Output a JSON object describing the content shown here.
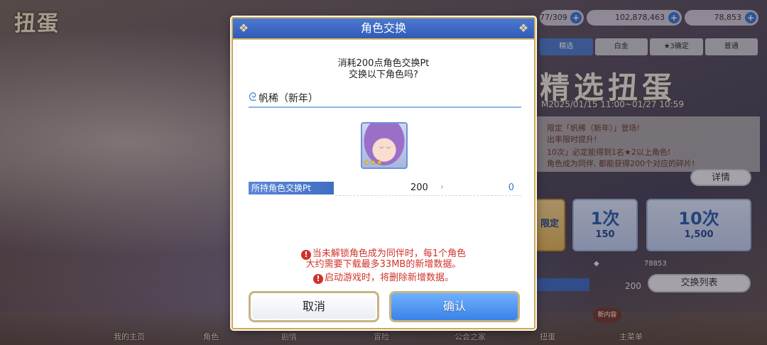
{
  "background": {
    "logo": "扭蛋",
    "resources": {
      "stamina": "77/309",
      "mana": "102,878,463",
      "jewels": "78,853"
    },
    "tabs": [
      "精选",
      "白金",
      "★3确定",
      "普通"
    ],
    "title": "精选扭蛋",
    "period": "M2025/01/15 11:00~01/27 10:59",
    "info_lines": [
      "限定「帆稀（新年）」登场!",
      "出率限时提升!",
      "10次」必定能得到1名★2以上角色!",
      "角色成为同伴, 都能获得200个对应的碎片!"
    ],
    "detail_label": "详情",
    "roll_single": {
      "count": "1次",
      "cost": "150"
    },
    "roll_ten": {
      "count": "10次",
      "cost": "1,500"
    },
    "roll_limited": {
      "label": "限定"
    },
    "currency_row": "78853",
    "left_banner_value": "200",
    "pt_value": "200",
    "exchange_list_label": "交换列表",
    "nav": [
      "我的主页",
      "角色",
      "剧情",
      "冒险",
      "公会之家",
      "扭蛋",
      "主菜单"
    ],
    "new_badge": "新内容"
  },
  "dialog": {
    "title": "角色交换",
    "question_line1": "消耗200点角色交换Pt",
    "question_line2": "交换以下角色吗?",
    "character_name": "帆稀（新年）",
    "character_stars": "★★★",
    "pt_label": "所持角色交换Pt",
    "pt_cost": "200",
    "pt_remaining": "0",
    "warning_line1": "当未解锁角色成为同伴时，每1个角色",
    "warning_line2": "大约需要下载最多33MB的新增数据。",
    "warning_line3": "启动游戏时，将删除新增数据。",
    "cancel_label": "取消",
    "confirm_label": "确认"
  }
}
